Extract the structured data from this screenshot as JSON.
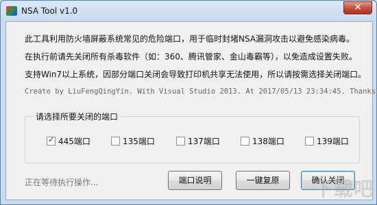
{
  "window": {
    "title": "NSA Tool v1.0",
    "close_glyph": "✕"
  },
  "description": {
    "line1": "此工具利用防火墙屏蔽系统常见的危险端口，用于临时封堵NSA漏洞攻击以避免感染病毒。",
    "line2": "在执行前请先关闭所有杀毒软件（如：360、腾讯管家、金山毒霸等），以免造成设置失败。",
    "line3": "支持Win7以上系统，因部分端口关闭会导致打印机共享无法使用，所以请按需选择关闭端口。"
  },
  "credit": "Create by LiuFengQingYin. With Visual Studio 2013. At 2017/05/13 23:34:45. Thanks!",
  "ports_group": {
    "label": "请选择所要关闭的端口",
    "items": [
      {
        "label": "445端口",
        "checked": true
      },
      {
        "label": "135端口",
        "checked": false
      },
      {
        "label": "137端口",
        "checked": false
      },
      {
        "label": "138端口",
        "checked": false
      },
      {
        "label": "139端口",
        "checked": false
      }
    ]
  },
  "status": "正在等待执行操作...",
  "buttons": {
    "ports_info": "端口说明",
    "restore": "一键复原",
    "confirm_close": "确认关闭"
  },
  "watermark": "下载吧"
}
